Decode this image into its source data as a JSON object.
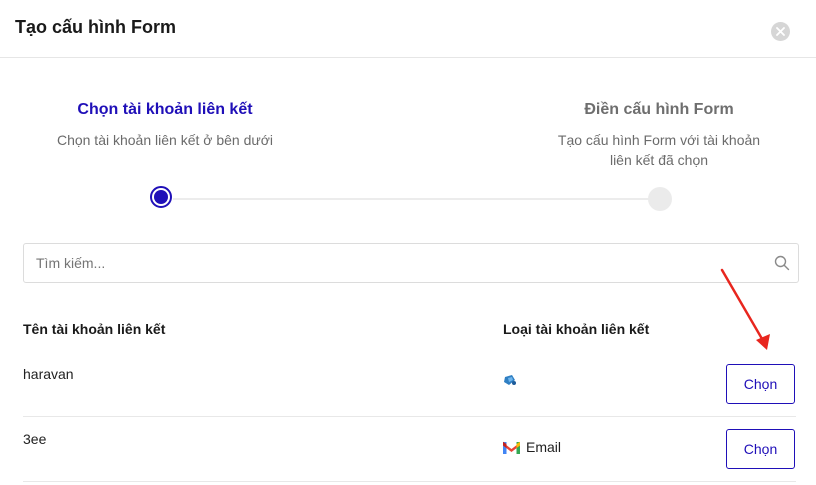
{
  "modal": {
    "title": "Tạo cấu hình Form",
    "close_icon": "close-icon"
  },
  "steps": [
    {
      "title": "Chọn tài khoản liên kết",
      "description": "Chọn tài khoản liên kết ở bên dưới",
      "state": "active"
    },
    {
      "title": "Điền cấu hình Form",
      "description": "Tạo cấu hình Form với tài khoản liên kết đã chọn",
      "state": "inactive"
    }
  ],
  "colors": {
    "accent": "#1f0fb8",
    "annotation_arrow": "#e8261e"
  },
  "search": {
    "placeholder": "Tìm kiếm...",
    "value": "",
    "icon": "search-icon"
  },
  "table": {
    "headers": [
      "Tên tài khoản liên kết",
      "Loại tài khoản liên kết"
    ],
    "rows": [
      {
        "name": "haravan",
        "type_label": "",
        "type_icon": "haravan-logo-icon",
        "action_label": "Chọn"
      },
      {
        "name": "3ee",
        "type_label": "Email",
        "type_icon": "gmail-icon",
        "action_label": "Chọn"
      }
    ]
  }
}
